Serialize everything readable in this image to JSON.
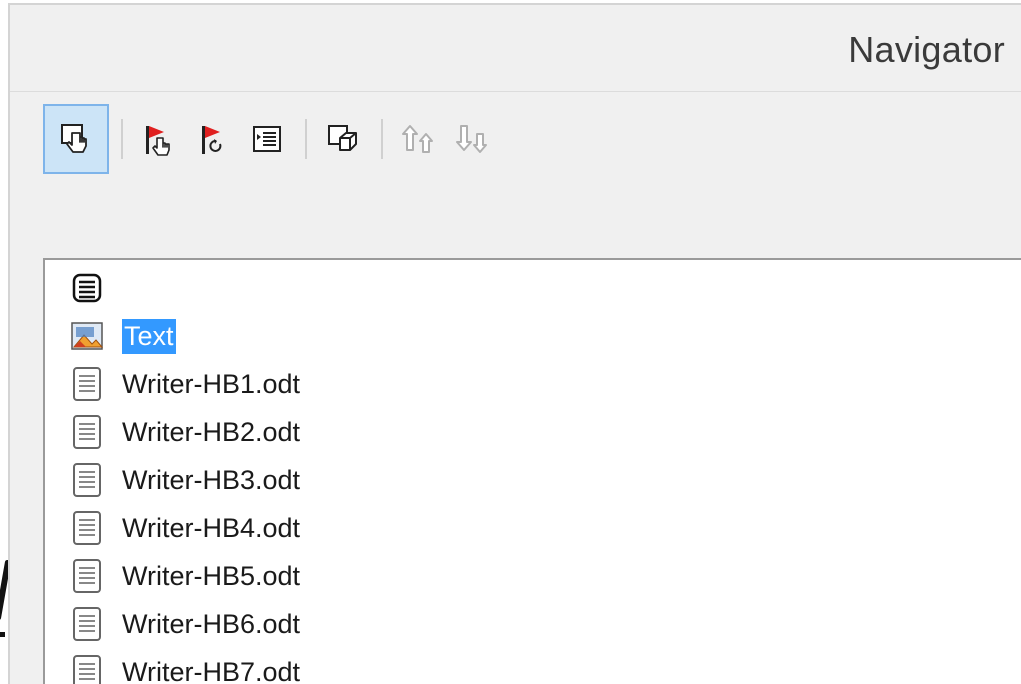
{
  "window": {
    "title": "Navigator"
  },
  "toolbar": {
    "buttons": [
      {
        "name": "drag-mode",
        "icon": "drag-hand-icon",
        "active": true
      },
      {
        "name": "insert-as-hyperlink",
        "icon": "flag-hand-icon",
        "active": false
      },
      {
        "name": "insert-as-link",
        "icon": "flag-link-icon",
        "active": false
      },
      {
        "name": "toggle-content",
        "icon": "content-view-icon",
        "active": false
      },
      {
        "name": "show-shapes",
        "icon": "shapes-icon",
        "active": false
      },
      {
        "name": "move-up",
        "icon": "arrows-up-icon",
        "active": false
      },
      {
        "name": "move-down",
        "icon": "arrows-down-icon",
        "active": false
      }
    ]
  },
  "tree": {
    "items": [
      {
        "label": "",
        "icon": "list-document-icon",
        "selected": false
      },
      {
        "label": "Text",
        "icon": "image-graphic-icon",
        "selected": true
      },
      {
        "label": "Writer-HB1.odt",
        "icon": "text-document-icon",
        "selected": false
      },
      {
        "label": "Writer-HB2.odt",
        "icon": "text-document-icon",
        "selected": false
      },
      {
        "label": "Writer-HB3.odt",
        "icon": "text-document-icon",
        "selected": false
      },
      {
        "label": "Writer-HB4.odt",
        "icon": "text-document-icon",
        "selected": false
      },
      {
        "label": "Writer-HB5.odt",
        "icon": "text-document-icon",
        "selected": false
      },
      {
        "label": "Writer-HB6.odt",
        "icon": "text-document-icon",
        "selected": false
      },
      {
        "label": "Writer-HB7.odt",
        "icon": "text-document-icon",
        "selected": false
      }
    ]
  },
  "colors": {
    "selection": "#3399ff",
    "active_button": "#cce4f7",
    "active_border": "#7eb4ea",
    "panel_bg": "#f0f0f0"
  }
}
